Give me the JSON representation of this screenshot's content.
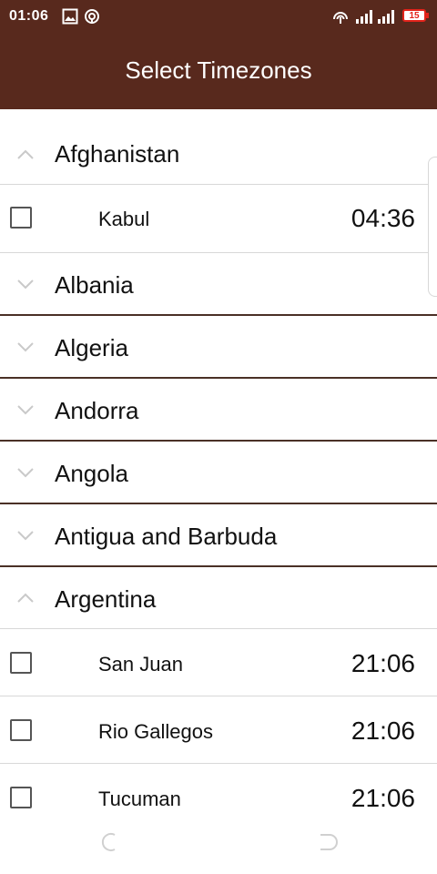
{
  "status_bar": {
    "time": "01:06",
    "battery": "15"
  },
  "header": {
    "title": "Select Timezones"
  },
  "list": {
    "afghanistan": {
      "name": "Afghanistan",
      "zones": [
        {
          "name": "Kabul",
          "time": "04:36"
        }
      ]
    },
    "albania": {
      "name": "Albania"
    },
    "algeria": {
      "name": "Algeria"
    },
    "andorra": {
      "name": "Andorra"
    },
    "angola": {
      "name": "Angola"
    },
    "antigua": {
      "name": "Antigua and Barbuda"
    },
    "argentina": {
      "name": "Argentina",
      "zones": [
        {
          "name": "San Juan",
          "time": "21:06"
        },
        {
          "name": "Rio Gallegos",
          "time": "21:06"
        },
        {
          "name": "Tucuman",
          "time": "21:06"
        }
      ]
    }
  },
  "colors": {
    "header_bg": "#58291d",
    "divider": "#4a3026"
  },
  "icons": {
    "expanded": "chevron-up-icon",
    "collapsed": "chevron-down-icon",
    "checkbox": "checkbox-icon"
  }
}
